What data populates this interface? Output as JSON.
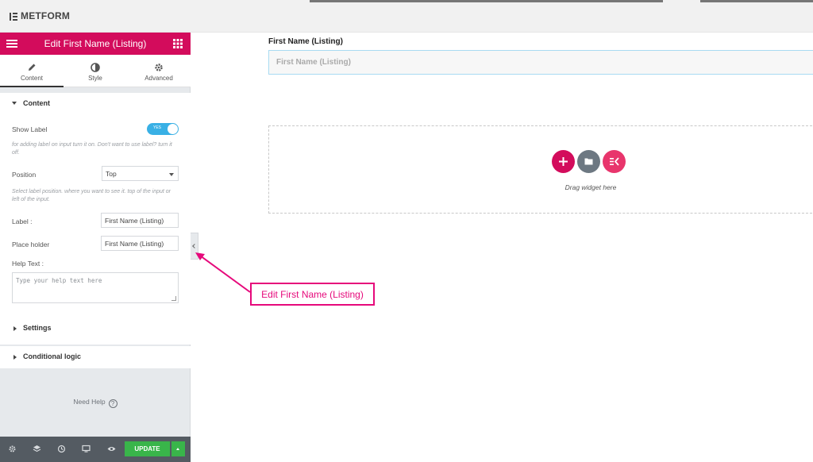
{
  "topbar": {
    "brand": "METFORM",
    "logo_icon": "elementor-icon"
  },
  "panel": {
    "title": "Edit First Name (Listing)",
    "header_colors": {
      "accent": "#d30c5c"
    },
    "tabs": [
      {
        "label": "Content",
        "icon": "pencil-icon",
        "active": true
      },
      {
        "label": "Style",
        "icon": "half-circle-icon",
        "active": false
      },
      {
        "label": "Advanced",
        "icon": "gear-icon",
        "active": false
      }
    ],
    "content_section": {
      "title": "Content",
      "show_label": {
        "label": "Show Label",
        "toggle_text": "YES",
        "value": true
      },
      "show_label_hint": "for adding label on input turn it on. Don't want to use label? turn it off.",
      "position": {
        "label": "Position",
        "value": "Top"
      },
      "position_hint": "Select label position. where you want to see it. top of the input or left of the input.",
      "label_field": {
        "label": "Label :",
        "value": "First Name (Listing)"
      },
      "placeholder_field": {
        "label": "Place holder",
        "value": "First Name (Listing)"
      },
      "help_text": {
        "label": "Help Text :",
        "placeholder": "Type your help text here"
      }
    },
    "settings_section": {
      "title": "Settings"
    },
    "conditional_section": {
      "title": "Conditional logic"
    },
    "need_help": "Need Help",
    "footer": {
      "icons": [
        "gear-icon",
        "layers-icon",
        "history-icon",
        "desktop-icon",
        "eye-icon"
      ],
      "update_label": "UPDATE"
    }
  },
  "canvas": {
    "field_label": "First Name (Listing)",
    "field_placeholder": "First Name (Listing)",
    "drop_text": "Drag widget here",
    "drop_buttons": [
      {
        "icon": "plus-icon",
        "color": "#d30c5c"
      },
      {
        "icon": "folder-icon",
        "color": "#6d7882"
      },
      {
        "icon": "elementskit-icon",
        "color": "#e8356c"
      }
    ]
  },
  "annotation": {
    "text": "Edit First Name (Listing)",
    "color": "#e6097b"
  }
}
